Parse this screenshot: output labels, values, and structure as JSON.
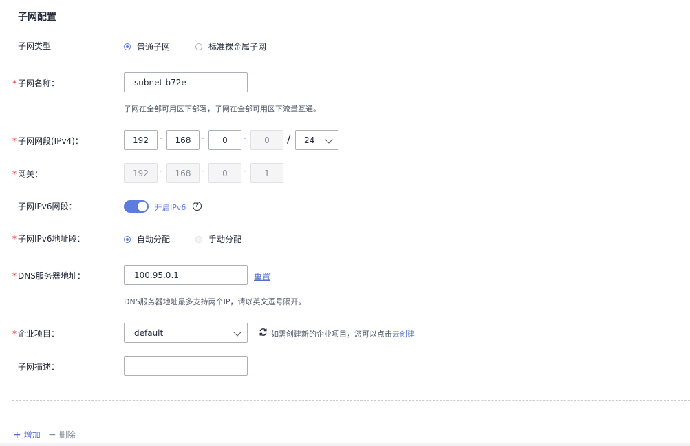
{
  "section_title": "子网配置",
  "subnet_type": {
    "label": "子网类型",
    "options": [
      "普通子网",
      "标准裸金属子网"
    ],
    "selected": "普通子网"
  },
  "subnet_name": {
    "label": "子网名称：",
    "value": "subnet-b72e",
    "hint": "子网在全部可用区下部署，子网在全部可用区下流量互通。"
  },
  "subnet_cidr": {
    "label": "子网网段(IPv4)：",
    "octets": [
      "192",
      "168",
      "0",
      "0"
    ],
    "slash": "/",
    "mask": "24"
  },
  "gateway": {
    "label": "网关：",
    "octets": [
      "192",
      "168",
      "0",
      "1"
    ]
  },
  "ipv6": {
    "label": "子网IPv6网段：",
    "toggle_label": "开启IPv6",
    "enabled": true,
    "help": "?"
  },
  "ipv6_addr": {
    "label": "子网IPv6地址段：",
    "options": [
      "自动分配",
      "手动分配"
    ],
    "selected": "自动分配"
  },
  "dns": {
    "label": "DNS服务器地址：",
    "value": "100.95.0.1",
    "reset": "重置",
    "hint": "DNS服务器地址最多支持两个IP，请以英文逗号隔开。"
  },
  "enterprise": {
    "label": "企业项目：",
    "value": "default",
    "hint_prefix": "如需创建新的企业项目，您可以点击",
    "hint_link": "去创建"
  },
  "description": {
    "label": "子网描述：",
    "value": ""
  },
  "footer": {
    "add": "增加",
    "delete": "删除"
  },
  "colors": {
    "accent": "#5e7ce0",
    "link": "#526ecc",
    "required": "#f5222d"
  }
}
